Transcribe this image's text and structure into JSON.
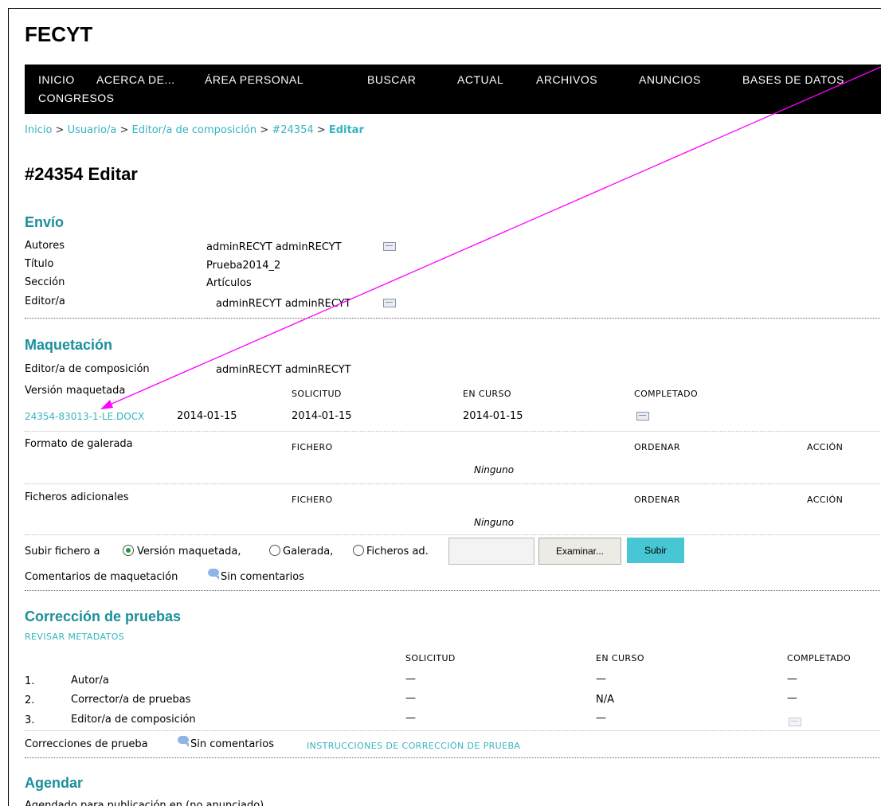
{
  "site_title": "FECYT",
  "nav": [
    "INICIO",
    "ACERCA DE...",
    "ÁREA PERSONAL",
    "BUSCAR",
    "ACTUAL",
    "ARCHIVOS",
    "ANUNCIOS",
    "BASES DE DATOS",
    "CONGRESOS"
  ],
  "breadcrumb": {
    "items": [
      "Inicio",
      "Usuario/a",
      "Editor/a de composición",
      "#24354"
    ],
    "current": "Editar",
    "sep": ">"
  },
  "page_title": "#24354 Editar",
  "envio": {
    "heading": "Envío",
    "rows": [
      {
        "label": "Autores",
        "value": "adminRECYT adminRECYT"
      },
      {
        "label": "Título",
        "value": "Prueba2014_2"
      },
      {
        "label": "Sección",
        "value": "Artículos"
      },
      {
        "label": "Editor/a",
        "value": "adminRECYT adminRECYT"
      }
    ]
  },
  "maquetacion": {
    "heading": "Maquetación",
    "editor_label": "Editor/a de composición",
    "editor_value": "adminRECYT adminRECYT",
    "version_label": "Versión maquetada",
    "col_solicitud": "SOLICITUD",
    "col_en_curso": "EN CURSO",
    "col_completado": "COMPLETADO",
    "file_link": "24354-83013-1-LE.DOCX",
    "file_date": "2014-01-15",
    "solicitud_date": "2014-01-15",
    "en_curso_date": "2014-01-15",
    "galerada_label": "Formato de galerada",
    "col_fichero": "FICHERO",
    "col_ordenar": "ORDENAR",
    "col_accion": "ACCIÓN",
    "ninguno": "Ninguno",
    "adicionales_label": "Ficheros adicionales",
    "upload_label": "Subir fichero a",
    "radio_options": [
      "Versión maquetada,",
      "Galerada,",
      "Ficheros ad."
    ],
    "browse_label": "Examinar...",
    "upload_button": "Subir",
    "comments_label": "Comentarios de maquetación",
    "comments_value": "Sin comentarios"
  },
  "correccion": {
    "heading": "Corrección de pruebas",
    "revisar": "REVISAR METADATOS",
    "col_solicitud": "SOLICITUD",
    "col_en_curso": "EN CURSO",
    "col_completado": "COMPLETADO",
    "rows": [
      {
        "num": "1.",
        "label": "Autor/a",
        "solicitud": "—",
        "en_curso": "—",
        "completado": "—"
      },
      {
        "num": "2.",
        "label": "Corrector/a de pruebas",
        "solicitud": "—",
        "en_curso": "N/A",
        "completado": "—"
      },
      {
        "num": "3.",
        "label": "Editor/a de composición",
        "solicitud": "—",
        "en_curso": "—",
        "completado": ""
      }
    ],
    "footer_label": "Correcciones de prueba",
    "footer_value": "Sin comentarios",
    "instructions": "INSTRUCCIONES DE CORRECCIÓN DE PRUEBA"
  },
  "agendar": {
    "heading": "Agendar",
    "text": "Agendado para publicación en (no anunciado)"
  },
  "colors": {
    "accent": "#1a8f9c",
    "link": "#36b4c0",
    "arrow": "#ff00ff",
    "button": "#47c7d3"
  }
}
